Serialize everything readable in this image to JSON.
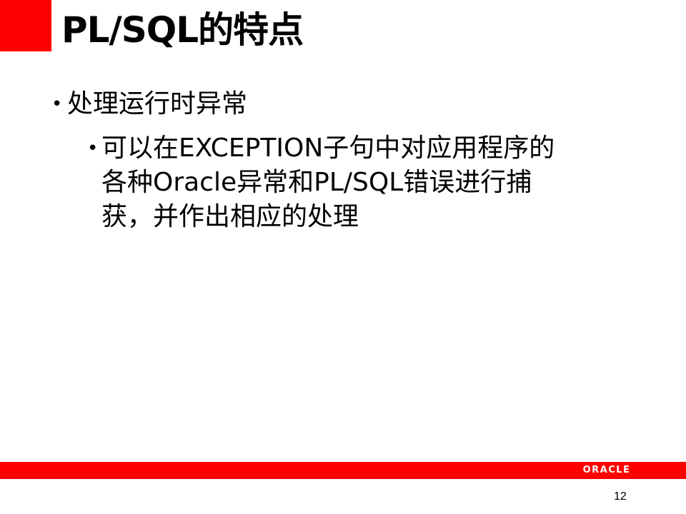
{
  "slide": {
    "title": "PL/SQL的特点",
    "bullets": [
      {
        "text": "处理运行时异常",
        "children": [
          {
            "lines": [
              "可以在EXCEPTION子句中对应用程序的",
              "各种Oracle异常和PL/SQL错误进行捕",
              "获，并作出相应的处理"
            ]
          }
        ]
      }
    ],
    "bullet_symbol": "•",
    "footer": {
      "logo_text": "ORACLE",
      "page_number": "12"
    }
  },
  "colors": {
    "accent_red": "#ff0000",
    "text": "#000000",
    "background": "#ffffff"
  }
}
